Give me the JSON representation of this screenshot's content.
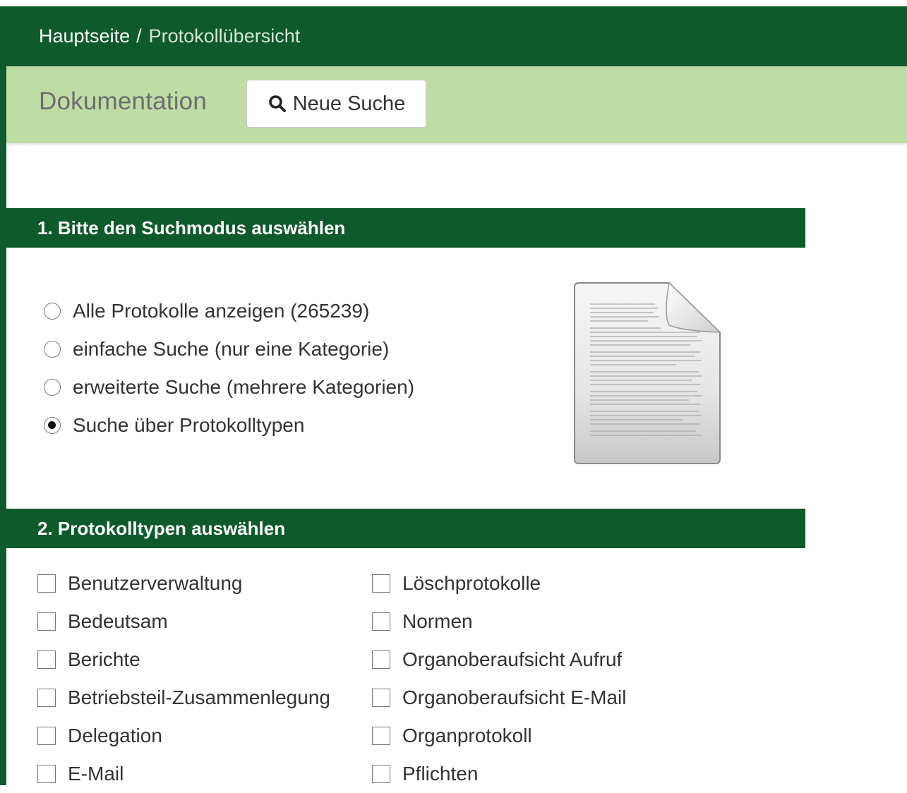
{
  "breadcrumb": {
    "home": "Hauptseite",
    "separator": "/",
    "current": "Protokollübersicht"
  },
  "toolbar": {
    "title": "Dokumentation",
    "new_search_label": "Neue Suche"
  },
  "section1": {
    "title": "1. Bitte den Suchmodus auswählen",
    "options": [
      {
        "label": "Alle Protokolle anzeigen (265239)",
        "checked": false
      },
      {
        "label": "einfache Suche (nur eine Kategorie)",
        "checked": false
      },
      {
        "label": "erweiterte Suche (mehrere Kategorien)",
        "checked": false
      },
      {
        "label": "Suche über Protokolltypen",
        "checked": true
      }
    ]
  },
  "section2": {
    "title": "2. Protokolltypen auswählen",
    "left": [
      {
        "label": "Benutzerverwaltung",
        "checked": false
      },
      {
        "label": "Bedeutsam",
        "checked": false
      },
      {
        "label": "Berichte",
        "checked": false
      },
      {
        "label": "Betriebsteil-Zusammenlegung",
        "checked": false
      },
      {
        "label": "Delegation",
        "checked": false
      },
      {
        "label": "E-Mail",
        "checked": false
      }
    ],
    "right": [
      {
        "label": "Löschprotokolle",
        "checked": false
      },
      {
        "label": "Normen",
        "checked": false
      },
      {
        "label": "Organoberaufsicht Aufruf",
        "checked": false
      },
      {
        "label": "Organoberaufsicht E-Mail",
        "checked": false
      },
      {
        "label": "Organprotokoll",
        "checked": false
      },
      {
        "label": "Pflichten",
        "checked": false
      }
    ]
  },
  "colors": {
    "primary_green": "#0e5a2b",
    "light_green": "#bedda5"
  },
  "icons": {
    "search": "search-icon",
    "document": "document-icon"
  }
}
